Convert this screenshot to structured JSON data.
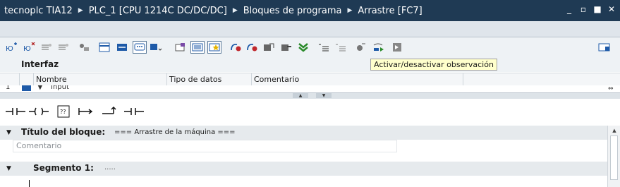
{
  "titlebar": {
    "crumbs": [
      "tecnoplc TIA12",
      "PLC_1 [CPU 1214C DC/DC/DC]",
      "Bloques de programa",
      "Arrastre [FC7]"
    ],
    "separator": "▶",
    "controls": [
      "_",
      "▫",
      "■",
      "✕"
    ]
  },
  "toolbar": {
    "tooltip": "Activar/desactivar observación",
    "icons": [
      "insert-row-icon",
      "delete-row-icon",
      "insert-column-icon",
      "delete-column-icon",
      "network-icon",
      "block-interface-icon",
      "comment-toggle-icon",
      "absolute-operands-icon",
      "favorites-icon",
      "sort-icon",
      "zoom-in-icon",
      "zoom-out-icon",
      "go-to-error-icon",
      "go-to-next-error-icon",
      "reset-start-icon",
      "monitor-on-off-icon",
      "indent-icon",
      "outdent-icon",
      "goto-icon",
      "monitor-icon",
      "snapshot-icon",
      "panel-toggle-icon"
    ]
  },
  "interface": {
    "title": "Interfaz",
    "columns": [
      "Nombre",
      "Tipo de datos",
      "Comentario"
    ],
    "row": {
      "number": "1",
      "name": "Input"
    }
  },
  "ladder": {
    "elements": [
      "contact-no-icon",
      "coil-icon",
      "empty-box-icon",
      "open-branch-icon",
      "close-branch-icon",
      "contact-nc-icon"
    ]
  },
  "block": {
    "title_label": "Título del bloque:",
    "title_value": "=== Arrastre de la máquina ===",
    "comment_placeholder": "Comentario"
  },
  "segment": {
    "label": "Segmento 1:",
    "value": "....."
  },
  "colors": {
    "titlebar": "#1f3a54",
    "toolbar_bg": "#eef2f5",
    "header_bg": "#e6eaed",
    "tooltip_bg": "#ffffcc"
  }
}
